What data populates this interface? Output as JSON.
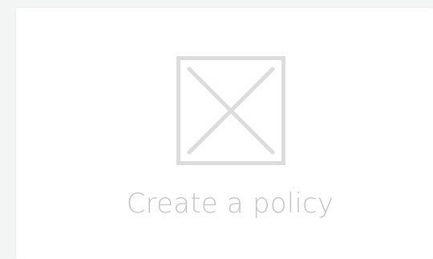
{
  "card": {
    "label": "Create a policy",
    "icon": "image-placeholder-icon"
  },
  "colors": {
    "background": "#f3f4f4",
    "card": "#ffffff",
    "icon": "#dcdcdc",
    "label": "#c4c4c4"
  }
}
